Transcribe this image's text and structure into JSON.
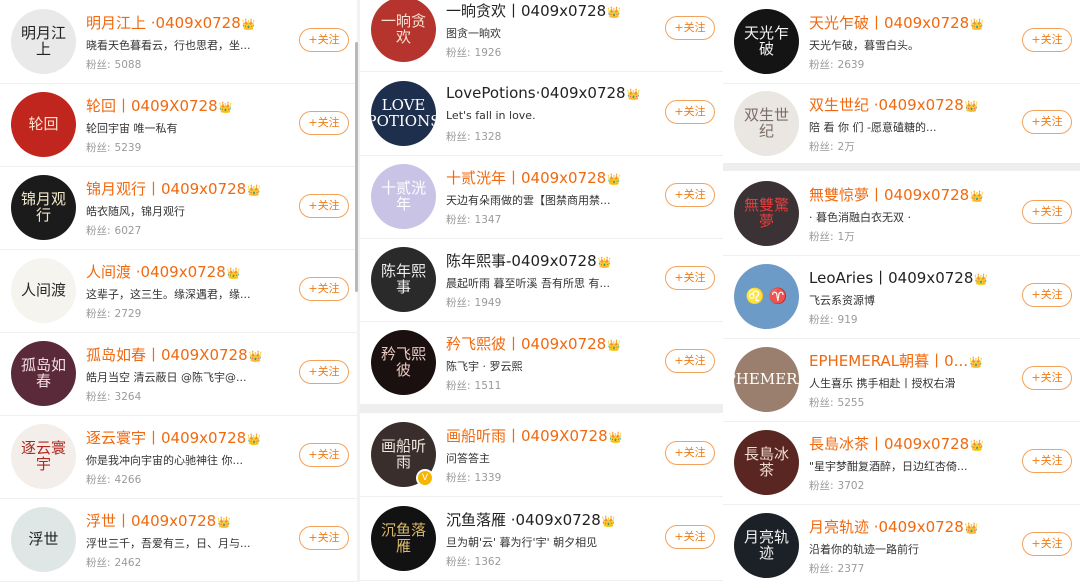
{
  "follow_label": "+关注",
  "fans_label": "粉丝:",
  "crown_icon": "👑",
  "verified_icon": "V",
  "columns": [
    [
      {
        "name": "明月江上 ·0409x0728",
        "desc": "晓看天色暮看云，行也思君，坐...",
        "fans": "5088",
        "avatar_text": "明月江上",
        "avatar_bg": "#e9e9e9",
        "avatar_fg": "#222222",
        "name_color": "orange"
      },
      {
        "name": "轮回丨0409X0728",
        "desc": "轮回宇宙 唯一私有",
        "fans": "5239",
        "avatar_text": "轮回",
        "avatar_bg": "#c0261d",
        "avatar_fg": "#fbe6d0",
        "name_color": "orange"
      },
      {
        "name": "锦月观行丨0409x0728",
        "desc": "皓衣随风，锦月观行",
        "fans": "6027",
        "avatar_text": "锦月观行",
        "avatar_bg": "#1b1b1b",
        "avatar_fg": "#f2e7c9",
        "name_color": "orange"
      },
      {
        "name": "人间渡 ·0409x0728",
        "desc": "这辈子，这三生。缘深遇君，缘...",
        "fans": "2729",
        "avatar_text": "人间渡",
        "avatar_bg": "#f6f4ee",
        "avatar_fg": "#2a2a2a",
        "name_color": "orange"
      },
      {
        "name": "孤岛如春丨0409X0728",
        "desc": "皓月当空 清云蔽日 @陈飞宇@...",
        "fans": "3264",
        "avatar_text": "孤岛如春",
        "avatar_bg": "#5a2a3a",
        "avatar_fg": "#f0dde0",
        "name_color": "orange"
      },
      {
        "name": "逐云寰宇丨0409x0728",
        "desc": "你是我冲向宇宙的心驰神往 你...",
        "fans": "4266",
        "avatar_text": "逐云寰宇",
        "avatar_bg": "#f3eeea",
        "avatar_fg": "#b2281f",
        "name_color": "orange"
      },
      {
        "name": "浮世丨0409x0728",
        "desc": "浮世三千，吾爱有三，日、月与...",
        "fans": "2462",
        "avatar_text": "浮世",
        "avatar_bg": "#dfe6e6",
        "avatar_fg": "#1f1f1f",
        "name_color": "orange"
      }
    ],
    [
      {
        "name": "一晌贪欢丨0409x0728",
        "desc": "图贪一晌欢",
        "fans": "1926",
        "avatar_text": "一晌贪欢",
        "avatar_bg": "#b5352e",
        "avatar_fg": "#fbe3d3",
        "name_color": "dark"
      },
      {
        "name": "LovePotions·0409x0728",
        "desc": "Let's fall in love.",
        "fans": "1328",
        "avatar_text": "LOVE POTIONS",
        "avatar_bg": "#1e2f4e",
        "avatar_fg": "#ffffff",
        "name_color": "dark"
      },
      {
        "name": "十贰洸年丨0409x0728",
        "desc": "天边有朵雨做的雲【图禁商用禁...",
        "fans": "1347",
        "avatar_text": "十贰洸年",
        "avatar_bg": "#c9c3e6",
        "avatar_fg": "#ffffff",
        "name_color": "orange"
      },
      {
        "name": "陈年熙事-0409x0728",
        "desc": "晨起听雨 暮至听溪 吾有所思 有...",
        "fans": "1949",
        "avatar_text": "陈年熙事",
        "avatar_bg": "#2a2a2a",
        "avatar_fg": "#eeeeee",
        "name_color": "dark"
      },
      {
        "name": "矜飞熙彼丨0409x0728",
        "desc": "陈飞宇 · 罗云熙",
        "fans": "1511",
        "avatar_text": "矜飞熙彼",
        "avatar_bg": "#1a1010",
        "avatar_fg": "#e8c9c0",
        "name_color": "orange"
      },
      {
        "name": "画船听雨丨0409X0728",
        "desc": "问答答主",
        "fans": "1339",
        "avatar_text": "画船听雨",
        "avatar_bg": "#3a2e2c",
        "avatar_fg": "#f1e6df",
        "name_color": "orange"
      },
      {
        "name": "沉鱼落雁 ·0409x0728",
        "desc": "旦为朝'云' 暮为行'宇' 朝夕相见",
        "fans": "1362",
        "avatar_text": "沉鱼落雁",
        "avatar_bg": "#121212",
        "avatar_fg": "#d8b86b",
        "name_color": "dark"
      }
    ],
    [
      {
        "name": "天光乍破丨0409x0728",
        "desc": "天光乍破，暮雪白头。",
        "fans": "2639",
        "avatar_text": "天光乍破",
        "avatar_bg": "#141414",
        "avatar_fg": "#f5f5f5",
        "name_color": "orange"
      },
      {
        "name": "双生世纪 ·0409x0728",
        "desc": "陪 看 你 们          -愿意磕糖的...",
        "fans": "2万",
        "avatar_text": "双生世纪",
        "avatar_bg": "#eae6e2",
        "avatar_fg": "#7a6d66",
        "name_color": "orange"
      },
      {
        "name": "無雙惊夢丨0409x0728",
        "desc": "· 暮色消融白衣无双 ·",
        "fans": "1万",
        "avatar_text": "無雙驚夢",
        "avatar_bg": "#3a3234",
        "avatar_fg": "#e53d3d",
        "name_color": "orange"
      },
      {
        "name": "LeoAries丨0409x0728",
        "desc": "飞云系资源博",
        "fans": "919",
        "avatar_text": "♌ ♈",
        "avatar_bg": "#6d9bc7",
        "avatar_fg": "#ffffff",
        "name_color": "dark"
      },
      {
        "name": "EPHEMERAL朝暮丨0...",
        "desc": "人生喜乐 携手相赴丨授权右滑",
        "fans": "5255",
        "avatar_text": "EPHEMERAL",
        "avatar_bg": "#9b7f6e",
        "avatar_fg": "#ffffff",
        "name_color": "orange"
      },
      {
        "name": "長島冰茶丨0409x0728",
        "desc": "\"星宇梦酣复酒醉，日边红杏倚...",
        "fans": "3702",
        "avatar_text": "長島冰茶",
        "avatar_bg": "#5a2622",
        "avatar_fg": "#f0dcd0",
        "name_color": "orange"
      },
      {
        "name": "月亮轨迹 ·0409x0728",
        "desc": "沿着你的轨迹一路前行",
        "fans": "2377",
        "avatar_text": "月亮轨迹",
        "avatar_bg": "#1c2027",
        "avatar_fg": "#f2f2f2",
        "name_color": "orange"
      }
    ]
  ]
}
